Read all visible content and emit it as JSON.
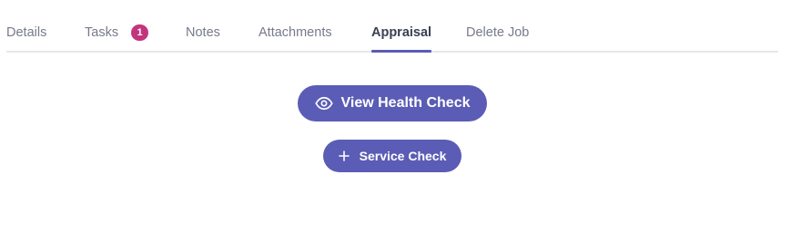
{
  "tabs": {
    "details": "Details",
    "tasks": "Tasks",
    "tasks_badge": "1",
    "notes": "Notes",
    "attachments": "Attachments",
    "appraisal": "Appraisal",
    "delete_job": "Delete Job",
    "active": "Appraisal"
  },
  "actions": {
    "view_health_check": {
      "label": "View Health Check",
      "icon": "eye-icon"
    },
    "service_check": {
      "label": "Service Check",
      "icon": "plus-icon"
    }
  },
  "colors": {
    "accent": "#5b5cb5",
    "badge": "#c2357c",
    "tab_text": "#767a8c",
    "tab_active_text": "#3b3f52",
    "divider": "#e6e7ec"
  }
}
